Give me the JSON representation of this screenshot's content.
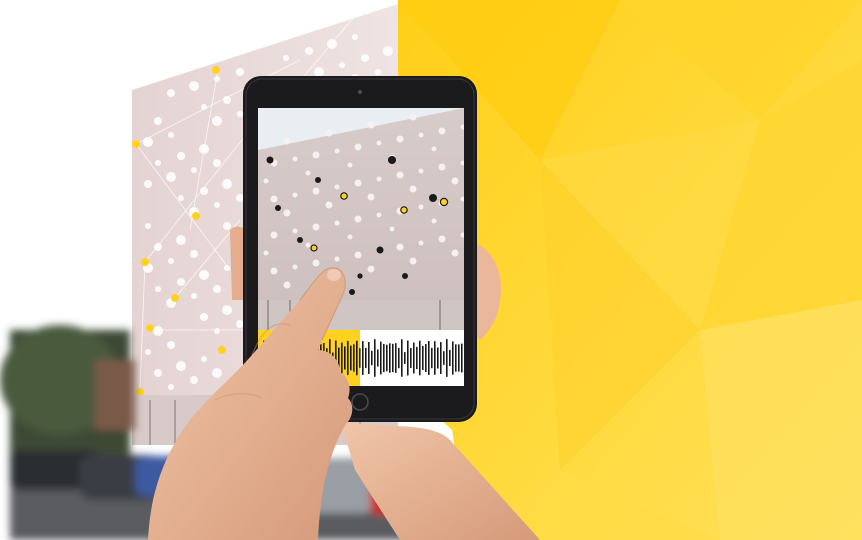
{
  "image": {
    "subject": "hand-holding-tablet-over-building-facade",
    "colors": {
      "accent": "#ffd21f",
      "accent_dark": "#f6c400",
      "facade": "#e9dcdc",
      "bezel": "#1b1b1d",
      "sky": "#ffffff",
      "skin": "#e8b89a"
    }
  }
}
